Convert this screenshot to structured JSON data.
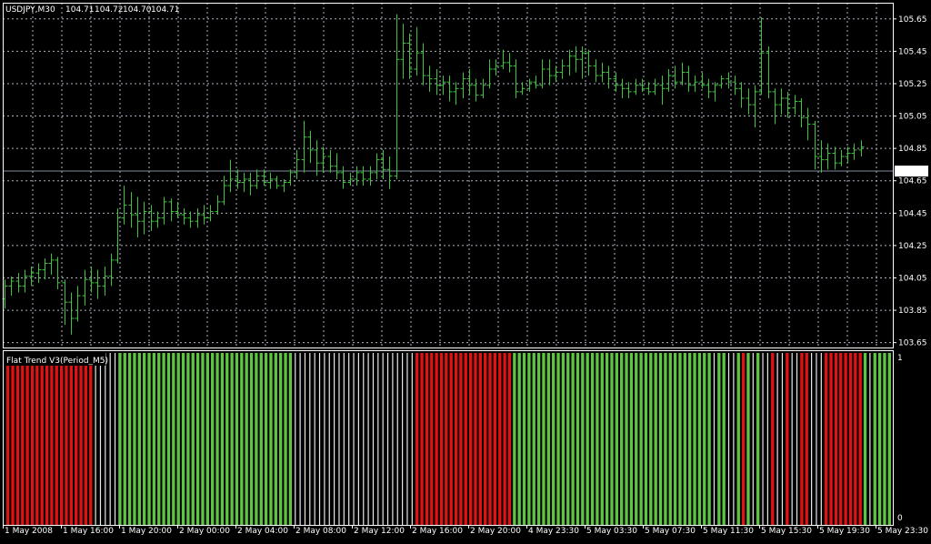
{
  "colors": {
    "background": "#000000",
    "frame": "#ffffff",
    "grid": "#aab2c0",
    "price_bar": "#3cc53c",
    "current_line": "#7f8aa0",
    "indicator_up": "#5fc444",
    "indicator_down": "#e01212",
    "indicator_flat": "#e8e8e8",
    "text": "#ffffff"
  },
  "chart_data": [
    {
      "type": "ohlc",
      "title": "USDJPY,M30",
      "ohlc_readout": [
        "104.71",
        "104.72",
        "104.70",
        "104.71"
      ],
      "current_price_label": "104.71",
      "current_price": 104.71,
      "ylim": [
        103.62,
        105.75
      ],
      "y_ticks": [
        "105.65",
        "105.45",
        "105.25",
        "105.05",
        "104.85",
        "104.65",
        "104.45",
        "104.25",
        "104.05",
        "103.85",
        "103.65"
      ],
      "grid": true,
      "bars": [
        {
          "o": 103.92,
          "h": 104.04,
          "l": 103.86,
          "c": 104.0
        },
        {
          "o": 104.0,
          "h": 104.06,
          "l": 103.94,
          "c": 104.03
        },
        {
          "o": 104.03,
          "h": 104.08,
          "l": 103.96,
          "c": 104.0
        },
        {
          "o": 104.0,
          "h": 104.1,
          "l": 103.96,
          "c": 104.06
        },
        {
          "o": 104.06,
          "h": 104.12,
          "l": 104.0,
          "c": 104.08
        },
        {
          "o": 104.08,
          "h": 104.14,
          "l": 104.02,
          "c": 104.1
        },
        {
          "o": 104.1,
          "h": 104.17,
          "l": 104.04,
          "c": 104.14
        },
        {
          "o": 104.14,
          "h": 104.2,
          "l": 104.07,
          "c": 104.16
        },
        {
          "o": 104.16,
          "h": 104.18,
          "l": 103.98,
          "c": 104.02
        },
        {
          "o": 104.02,
          "h": 104.04,
          "l": 103.76,
          "c": 103.9
        },
        {
          "o": 103.9,
          "h": 103.96,
          "l": 103.7,
          "c": 103.8
        },
        {
          "o": 103.8,
          "h": 104.0,
          "l": 103.78,
          "c": 103.94
        },
        {
          "o": 103.94,
          "h": 104.1,
          "l": 103.88,
          "c": 104.04
        },
        {
          "o": 104.04,
          "h": 104.12,
          "l": 103.96,
          "c": 104.02
        },
        {
          "o": 104.02,
          "h": 104.1,
          "l": 103.92,
          "c": 104.0
        },
        {
          "o": 104.0,
          "h": 104.12,
          "l": 103.94,
          "c": 104.06
        },
        {
          "o": 104.06,
          "h": 104.2,
          "l": 104.0,
          "c": 104.16
        },
        {
          "o": 104.16,
          "h": 104.48,
          "l": 104.14,
          "c": 104.42
        },
        {
          "o": 104.42,
          "h": 104.62,
          "l": 104.38,
          "c": 104.5
        },
        {
          "o": 104.5,
          "h": 104.58,
          "l": 104.36,
          "c": 104.44
        },
        {
          "o": 104.44,
          "h": 104.55,
          "l": 104.3,
          "c": 104.4
        },
        {
          "o": 104.4,
          "h": 104.52,
          "l": 104.32,
          "c": 104.46
        },
        {
          "o": 104.46,
          "h": 104.5,
          "l": 104.34,
          "c": 104.4
        },
        {
          "o": 104.4,
          "h": 104.46,
          "l": 104.36,
          "c": 104.42
        },
        {
          "o": 104.42,
          "h": 104.55,
          "l": 104.38,
          "c": 104.52
        },
        {
          "o": 104.52,
          "h": 104.54,
          "l": 104.4,
          "c": 104.46
        },
        {
          "o": 104.46,
          "h": 104.52,
          "l": 104.42,
          "c": 104.44
        },
        {
          "o": 104.44,
          "h": 104.48,
          "l": 104.38,
          "c": 104.42
        },
        {
          "o": 104.42,
          "h": 104.46,
          "l": 104.36,
          "c": 104.4
        },
        {
          "o": 104.4,
          "h": 104.48,
          "l": 104.36,
          "c": 104.44
        },
        {
          "o": 104.44,
          "h": 104.5,
          "l": 104.38,
          "c": 104.42
        },
        {
          "o": 104.42,
          "h": 104.5,
          "l": 104.4,
          "c": 104.46
        },
        {
          "o": 104.46,
          "h": 104.56,
          "l": 104.44,
          "c": 104.52
        },
        {
          "o": 104.52,
          "h": 104.68,
          "l": 104.5,
          "c": 104.62
        },
        {
          "o": 104.62,
          "h": 104.78,
          "l": 104.58,
          "c": 104.66
        },
        {
          "o": 104.66,
          "h": 104.72,
          "l": 104.6,
          "c": 104.64
        },
        {
          "o": 104.64,
          "h": 104.7,
          "l": 104.58,
          "c": 104.66
        },
        {
          "o": 104.66,
          "h": 104.7,
          "l": 104.56,
          "c": 104.62
        },
        {
          "o": 104.62,
          "h": 104.72,
          "l": 104.6,
          "c": 104.68
        },
        {
          "o": 104.68,
          "h": 104.72,
          "l": 104.62,
          "c": 104.64
        },
        {
          "o": 104.64,
          "h": 104.7,
          "l": 104.6,
          "c": 104.66
        },
        {
          "o": 104.66,
          "h": 104.68,
          "l": 104.6,
          "c": 104.62
        },
        {
          "o": 104.62,
          "h": 104.66,
          "l": 104.58,
          "c": 104.64
        },
        {
          "o": 104.64,
          "h": 104.72,
          "l": 104.62,
          "c": 104.7
        },
        {
          "o": 104.7,
          "h": 104.84,
          "l": 104.66,
          "c": 104.78
        },
        {
          "o": 104.78,
          "h": 105.02,
          "l": 104.7,
          "c": 104.92
        },
        {
          "o": 104.92,
          "h": 104.96,
          "l": 104.76,
          "c": 104.84
        },
        {
          "o": 104.84,
          "h": 104.9,
          "l": 104.68,
          "c": 104.76
        },
        {
          "o": 104.76,
          "h": 104.86,
          "l": 104.7,
          "c": 104.8
        },
        {
          "o": 104.8,
          "h": 104.84,
          "l": 104.7,
          "c": 104.74
        },
        {
          "o": 104.74,
          "h": 104.82,
          "l": 104.66,
          "c": 104.7
        },
        {
          "o": 104.7,
          "h": 104.74,
          "l": 104.6,
          "c": 104.64
        },
        {
          "o": 104.64,
          "h": 104.7,
          "l": 104.62,
          "c": 104.66
        },
        {
          "o": 104.66,
          "h": 104.74,
          "l": 104.62,
          "c": 104.7
        },
        {
          "o": 104.7,
          "h": 104.74,
          "l": 104.62,
          "c": 104.66
        },
        {
          "o": 104.66,
          "h": 104.74,
          "l": 104.62,
          "c": 104.7
        },
        {
          "o": 104.7,
          "h": 104.82,
          "l": 104.66,
          "c": 104.78
        },
        {
          "o": 104.78,
          "h": 104.84,
          "l": 104.66,
          "c": 104.72
        },
        {
          "o": 104.72,
          "h": 104.8,
          "l": 104.6,
          "c": 104.68
        },
        {
          "o": 104.68,
          "h": 105.68,
          "l": 104.66,
          "c": 105.4
        },
        {
          "o": 105.4,
          "h": 105.62,
          "l": 105.28,
          "c": 105.5
        },
        {
          "o": 105.5,
          "h": 105.56,
          "l": 105.28,
          "c": 105.34
        },
        {
          "o": 105.34,
          "h": 105.6,
          "l": 105.3,
          "c": 105.44
        },
        {
          "o": 105.44,
          "h": 105.5,
          "l": 105.24,
          "c": 105.3
        },
        {
          "o": 105.3,
          "h": 105.36,
          "l": 105.2,
          "c": 105.28
        },
        {
          "o": 105.28,
          "h": 105.34,
          "l": 105.18,
          "c": 105.24
        },
        {
          "o": 105.24,
          "h": 105.3,
          "l": 105.18,
          "c": 105.26
        },
        {
          "o": 105.26,
          "h": 105.3,
          "l": 105.14,
          "c": 105.2
        },
        {
          "o": 105.2,
          "h": 105.26,
          "l": 105.12,
          "c": 105.22
        },
        {
          "o": 105.22,
          "h": 105.32,
          "l": 105.16,
          "c": 105.28
        },
        {
          "o": 105.28,
          "h": 105.34,
          "l": 105.18,
          "c": 105.24
        },
        {
          "o": 105.24,
          "h": 105.28,
          "l": 105.14,
          "c": 105.18
        },
        {
          "o": 105.18,
          "h": 105.28,
          "l": 105.16,
          "c": 105.24
        },
        {
          "o": 105.24,
          "h": 105.4,
          "l": 105.22,
          "c": 105.34
        },
        {
          "o": 105.34,
          "h": 105.4,
          "l": 105.3,
          "c": 105.36
        },
        {
          "o": 105.36,
          "h": 105.46,
          "l": 105.34,
          "c": 105.38
        },
        {
          "o": 105.38,
          "h": 105.44,
          "l": 105.32,
          "c": 105.36
        },
        {
          "o": 105.36,
          "h": 105.4,
          "l": 105.16,
          "c": 105.2
        },
        {
          "o": 105.2,
          "h": 105.26,
          "l": 105.18,
          "c": 105.22
        },
        {
          "o": 105.22,
          "h": 105.28,
          "l": 105.2,
          "c": 105.26
        },
        {
          "o": 105.26,
          "h": 105.3,
          "l": 105.22,
          "c": 105.24
        },
        {
          "o": 105.24,
          "h": 105.4,
          "l": 105.22,
          "c": 105.34
        },
        {
          "o": 105.34,
          "h": 105.4,
          "l": 105.24,
          "c": 105.3
        },
        {
          "o": 105.3,
          "h": 105.36,
          "l": 105.26,
          "c": 105.32
        },
        {
          "o": 105.32,
          "h": 105.4,
          "l": 105.28,
          "c": 105.36
        },
        {
          "o": 105.36,
          "h": 105.46,
          "l": 105.3,
          "c": 105.42
        },
        {
          "o": 105.42,
          "h": 105.48,
          "l": 105.32,
          "c": 105.4
        },
        {
          "o": 105.4,
          "h": 105.48,
          "l": 105.28,
          "c": 105.44
        },
        {
          "o": 105.44,
          "h": 105.46,
          "l": 105.3,
          "c": 105.36
        },
        {
          "o": 105.36,
          "h": 105.4,
          "l": 105.26,
          "c": 105.3
        },
        {
          "o": 105.3,
          "h": 105.38,
          "l": 105.26,
          "c": 105.32
        },
        {
          "o": 105.32,
          "h": 105.36,
          "l": 105.22,
          "c": 105.28
        },
        {
          "o": 105.28,
          "h": 105.32,
          "l": 105.2,
          "c": 105.24
        },
        {
          "o": 105.24,
          "h": 105.28,
          "l": 105.16,
          "c": 105.22
        },
        {
          "o": 105.22,
          "h": 105.26,
          "l": 105.16,
          "c": 105.2
        },
        {
          "o": 105.2,
          "h": 105.28,
          "l": 105.18,
          "c": 105.24
        },
        {
          "o": 105.24,
          "h": 105.28,
          "l": 105.2,
          "c": 105.22
        },
        {
          "o": 105.22,
          "h": 105.26,
          "l": 105.18,
          "c": 105.2
        },
        {
          "o": 105.2,
          "h": 105.28,
          "l": 105.18,
          "c": 105.24
        },
        {
          "o": 105.24,
          "h": 105.3,
          "l": 105.12,
          "c": 105.22
        },
        {
          "o": 105.22,
          "h": 105.34,
          "l": 105.2,
          "c": 105.3
        },
        {
          "o": 105.3,
          "h": 105.36,
          "l": 105.22,
          "c": 105.26
        },
        {
          "o": 105.26,
          "h": 105.38,
          "l": 105.24,
          "c": 105.32
        },
        {
          "o": 105.32,
          "h": 105.36,
          "l": 105.2,
          "c": 105.24
        },
        {
          "o": 105.24,
          "h": 105.3,
          "l": 105.2,
          "c": 105.26
        },
        {
          "o": 105.26,
          "h": 105.32,
          "l": 105.22,
          "c": 105.24
        },
        {
          "o": 105.24,
          "h": 105.28,
          "l": 105.16,
          "c": 105.2
        },
        {
          "o": 105.2,
          "h": 105.26,
          "l": 105.14,
          "c": 105.24
        },
        {
          "o": 105.24,
          "h": 105.3,
          "l": 105.22,
          "c": 105.28
        },
        {
          "o": 105.28,
          "h": 105.32,
          "l": 105.22,
          "c": 105.26
        },
        {
          "o": 105.26,
          "h": 105.3,
          "l": 105.18,
          "c": 105.22
        },
        {
          "o": 105.22,
          "h": 105.26,
          "l": 105.1,
          "c": 105.16
        },
        {
          "o": 105.16,
          "h": 105.22,
          "l": 105.06,
          "c": 105.12
        },
        {
          "o": 105.12,
          "h": 105.24,
          "l": 104.98,
          "c": 105.2
        },
        {
          "o": 105.2,
          "h": 105.66,
          "l": 105.18,
          "c": 105.44
        },
        {
          "o": 105.44,
          "h": 105.48,
          "l": 105.16,
          "c": 105.2
        },
        {
          "o": 105.2,
          "h": 105.22,
          "l": 105.0,
          "c": 105.12
        },
        {
          "o": 105.12,
          "h": 105.22,
          "l": 105.06,
          "c": 105.16
        },
        {
          "o": 105.16,
          "h": 105.2,
          "l": 105.04,
          "c": 105.1
        },
        {
          "o": 105.1,
          "h": 105.18,
          "l": 105.06,
          "c": 105.14
        },
        {
          "o": 105.14,
          "h": 105.16,
          "l": 104.98,
          "c": 105.04
        },
        {
          "o": 105.04,
          "h": 105.1,
          "l": 104.9,
          "c": 105.0
        },
        {
          "o": 105.0,
          "h": 105.02,
          "l": 104.72,
          "c": 104.8
        },
        {
          "o": 104.8,
          "h": 104.9,
          "l": 104.7,
          "c": 104.78
        },
        {
          "o": 104.78,
          "h": 104.88,
          "l": 104.72,
          "c": 104.82
        },
        {
          "o": 104.82,
          "h": 104.86,
          "l": 104.72,
          "c": 104.76
        },
        {
          "o": 104.76,
          "h": 104.84,
          "l": 104.74,
          "c": 104.8
        },
        {
          "o": 104.8,
          "h": 104.86,
          "l": 104.76,
          "c": 104.82
        },
        {
          "o": 104.82,
          "h": 104.88,
          "l": 104.78,
          "c": 104.84
        },
        {
          "o": 104.84,
          "h": 104.9,
          "l": 104.8,
          "c": 104.86
        }
      ]
    },
    {
      "type": "bar",
      "title": "Flat Trend V3(Period_M5)",
      "ylim": [
        0,
        1
      ],
      "y_ticks": [
        "1",
        "0"
      ],
      "x_ticks": [
        "1 May 2008",
        "1 May 16:00",
        "1 May 20:00",
        "2 May 00:00",
        "2 May 04:00",
        "2 May 08:00",
        "2 May 12:00",
        "2 May 16:00",
        "2 May 20:00",
        "4 May 23:30",
        "5 May 03:30",
        "5 May 07:30",
        "5 May 11:30",
        "5 May 15:30",
        "5 May 19:30",
        "5 May 23:30"
      ],
      "states": "DDDDDDDDDDDDDDDDDDFFFFFUUUUUUUUUUUUUUUUUUUUUUUUUUUUUUUUUUUUFFFFFFFFFFFFFFFFFFFFFFFFFDDDDDDDDDDDDDDDDDDDDUUUUUUUUUUUUUUUUUUUUUUUUUUUUUUUUUUUUUUUUUFUUFFUDUFUFFDFFDFFDDFFFDDDDDDDDUFUUUU",
      "state_legend": {
        "U": "up (green)",
        "D": "down (red)",
        "F": "flat (white)"
      }
    }
  ]
}
